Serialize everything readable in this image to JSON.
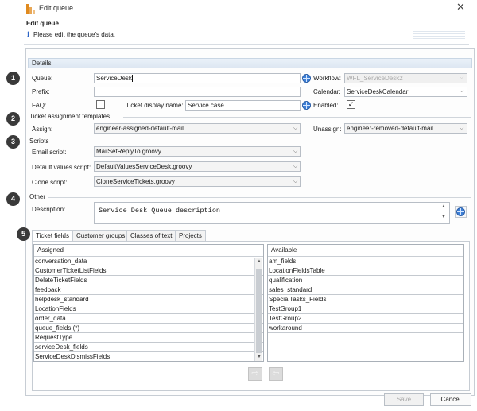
{
  "window": {
    "title": "Edit queue",
    "close_glyph": "✕"
  },
  "header": {
    "title": "Edit queue",
    "subtitle": "Please edit the queue's data.",
    "info_glyph": "i"
  },
  "details": {
    "section_title": "Details",
    "queue_label": "Queue:",
    "queue_value": "ServiceDesk",
    "workflow_label": "Workflow:",
    "workflow_value": "WFL_ServiceDesk2",
    "prefix_label": "Prefix:",
    "prefix_value": "",
    "calendar_label": "Calendar:",
    "calendar_value": "ServiceDeskCalendar",
    "faq_label": "FAQ:",
    "faq_checked": false,
    "ticket_display_name_label": "Ticket display name:",
    "ticket_display_name_value": "Service case",
    "enabled_label": "Enabled:",
    "enabled_checked": true
  },
  "ticket_assignment": {
    "group_title": "Ticket assignment templates",
    "assign_label": "Assign:",
    "assign_value": "engineer-assigned-default-mail",
    "unassign_label": "Unassign:",
    "unassign_value": "engineer-removed-default-mail"
  },
  "scripts": {
    "group_title": "Scripts",
    "email_label": "Email script:",
    "email_value": "MailSetReplyTo.groovy",
    "default_values_label": "Default values script:",
    "default_values_value": "DefaultValuesServiceDesk.groovy",
    "clone_label": "Clone script:",
    "clone_value": "CloneServiceTickets.groovy"
  },
  "other": {
    "group_title": "Other",
    "description_label": "Description:",
    "description_value": "Service Desk Queue description"
  },
  "badges": [
    "1",
    "2",
    "3",
    "4",
    "5"
  ],
  "tabs": [
    "Ticket fields",
    "Customer groups",
    "Classes of text",
    "Projects"
  ],
  "assigned_list": {
    "header": "Assigned",
    "items": [
      "conversation_data",
      "CustomerTicketListFields",
      "DeleteTicketFields",
      "feedback",
      "helpdesk_standard",
      "LocationFields",
      "order_data",
      "queue_fields (*)",
      "RequestType",
      "serviceDesk_fields",
      "ServiceDeskDismissFields"
    ]
  },
  "available_list": {
    "header": "Available",
    "items": [
      "am_fields",
      "LocationFieldsTable",
      "qualification",
      "sales_standard",
      "SpecialTasks_Fields",
      "TestGroup1",
      "TestGroup2",
      "workaround"
    ]
  },
  "buttons": {
    "save": "Save",
    "cancel": "Cancel",
    "move_right": "⇨",
    "move_left": "⇦"
  },
  "icons": {
    "chevron": "⌵",
    "scroll_up": "▲",
    "scroll_down": "▼",
    "check": "✓"
  },
  "colors": {
    "badge": "#3a3a3a",
    "section_bar": "#dde7f2",
    "info_icon": "#2b63c6",
    "globe_icon": "#3d7fd6",
    "app_icon": "#e08a1e"
  }
}
